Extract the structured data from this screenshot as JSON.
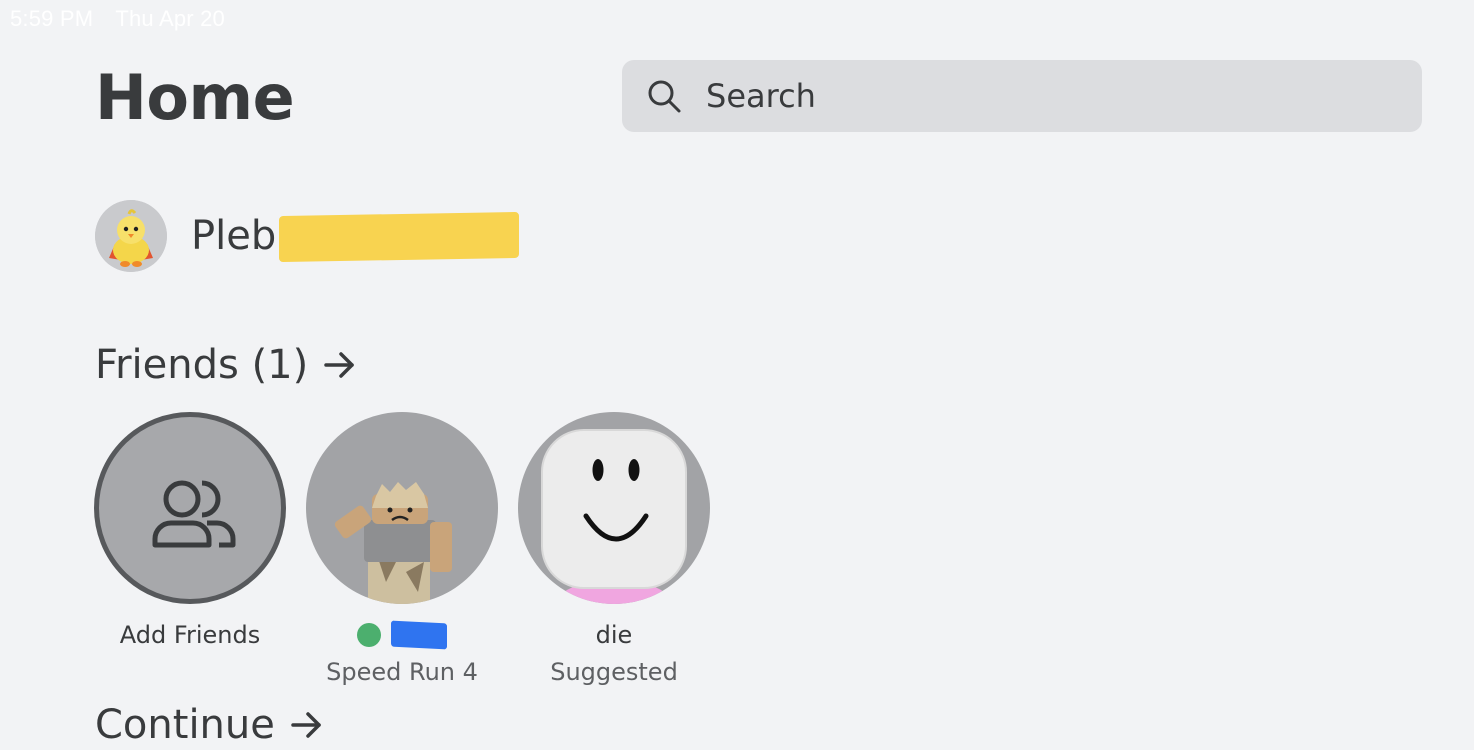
{
  "status_bar": {
    "time": "5:59 PM",
    "date": "Thu Apr 20"
  },
  "header": {
    "title": "Home"
  },
  "search": {
    "placeholder": "Search",
    "icon": "search-icon"
  },
  "profile": {
    "name": "Pleb",
    "avatar_icon": "chick-avatar"
  },
  "friends": {
    "heading": "Friends (1)",
    "arrow_icon": "arrow-right-icon",
    "tiles": [
      {
        "name": "Add Friends",
        "icon": "add-friends-icon"
      },
      {
        "name": "",
        "status": "Speed Run 4",
        "online": true
      },
      {
        "name": "die",
        "status": "Suggested"
      }
    ]
  },
  "continue": {
    "heading": "Continue",
    "arrow_icon": "arrow-right-icon"
  },
  "colors": {
    "background": "#f2f3f5",
    "text": "#393b3d",
    "search_bg": "#dcdde0",
    "online": "#4caf6e"
  }
}
